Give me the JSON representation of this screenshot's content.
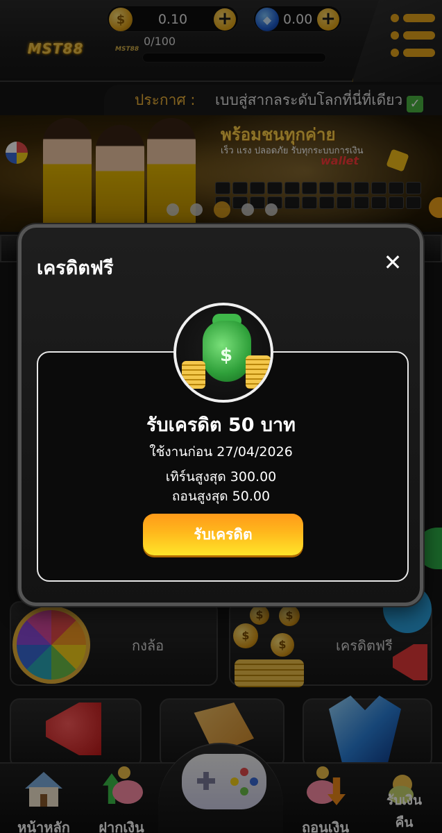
{
  "header": {
    "logo_text": "MST88",
    "mini_logo_text": "MST88",
    "coin_balance": "0.10",
    "gem_balance": "0.00",
    "plus_symbol": "+",
    "progress_text": "0/100",
    "progress_fraction": 0.0,
    "coin_icon": "coin-icon",
    "gem_icon": "gem-icon",
    "menu_icon": "hamburger-menu-icon"
  },
  "announcement": {
    "label": "ประกาศ :",
    "text": "เบบสู่สากลระดับโลกที่นี่ที่เดียว",
    "check_symbol": "✓"
  },
  "banner": {
    "headline": "พร้อมชนทุกค่าย",
    "subline": "เร็ว แรง ปลอดภัย รับทุกระบบการเงิน",
    "wallet_text": "wallet",
    "slide_count": 5,
    "active_slide": 3
  },
  "background_tiles": {
    "wheel_label": "กงล้อ",
    "free_credit_label": "เครดิตฟรี"
  },
  "modal": {
    "title": "เครดิตฟรี",
    "close_symbol": "✕",
    "bag_symbol": "$",
    "reward_title": "รับเครดิต 50 บาท",
    "expire_text": "ใช้งานก่อน 27/04/2026",
    "turnover_text": "เทิร์นสูงสุด 300.00",
    "withdraw_text": "ถอนสูงสุด 50.00",
    "claim_button": "รับเครดิต"
  },
  "bottom_nav": {
    "home": "หน้าหลัก",
    "deposit": "ฝากเงิน",
    "withdraw": "ถอนเงิน",
    "cashback_line1": "รับเงิน",
    "cashback_line2": "คืน"
  },
  "colors": {
    "accent": "#e9a820",
    "claim_gradient_top": "#ff9a1a",
    "claim_gradient_bottom": "#ffe52a",
    "announce_label": "#f3b63a"
  }
}
